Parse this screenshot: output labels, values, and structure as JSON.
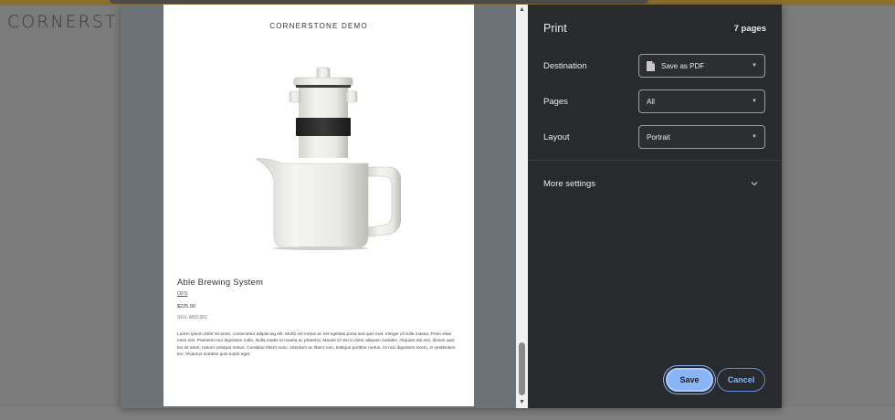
{
  "background": {
    "brand_text": "CORNERST"
  },
  "preview": {
    "store_name": "CORNERSTONE DEMO",
    "product_title": "Able Brewing System",
    "brand_link": "OFS",
    "price": "$225.00",
    "sku": "SKU: ABS-001",
    "description": "Lorem ipsum dolor sit amet, consectetur adipiscing elit. Morbi vel metus ac est egestas porta sed quis erat. Integer id nulla massa. Proin vitae enim nisi. Praesent non dignissim nulla. Nulla mattis id massa ac pharetra. Mauris et nisi in dolor aliquam sodales. Aliquam dui nisl, dictum quis leo sit amet, rutrum volutpat metus. Curabitur libero nunc, interdum ac libero non, tristique porttitor metus. Ut non dignissim lorem, in vestibulum leo. Vivamus sodales quis turpis eget."
  },
  "settings": {
    "title": "Print",
    "pages_count": "7 pages",
    "destination": {
      "label": "Destination",
      "value": "Save as PDF"
    },
    "pages": {
      "label": "Pages",
      "value": "All"
    },
    "layout": {
      "label": "Layout",
      "value": "Portrait"
    },
    "more_settings": "More settings",
    "save_label": "Save",
    "cancel_label": "Cancel"
  },
  "icons": {
    "destination": "document-icon",
    "dropdown": "caret-down-icon",
    "more": "chevron-down-icon"
  },
  "colors": {
    "panel_bg": "#292a2d",
    "accent": "#8ab4f8",
    "overlay": "#7b7b7b"
  }
}
